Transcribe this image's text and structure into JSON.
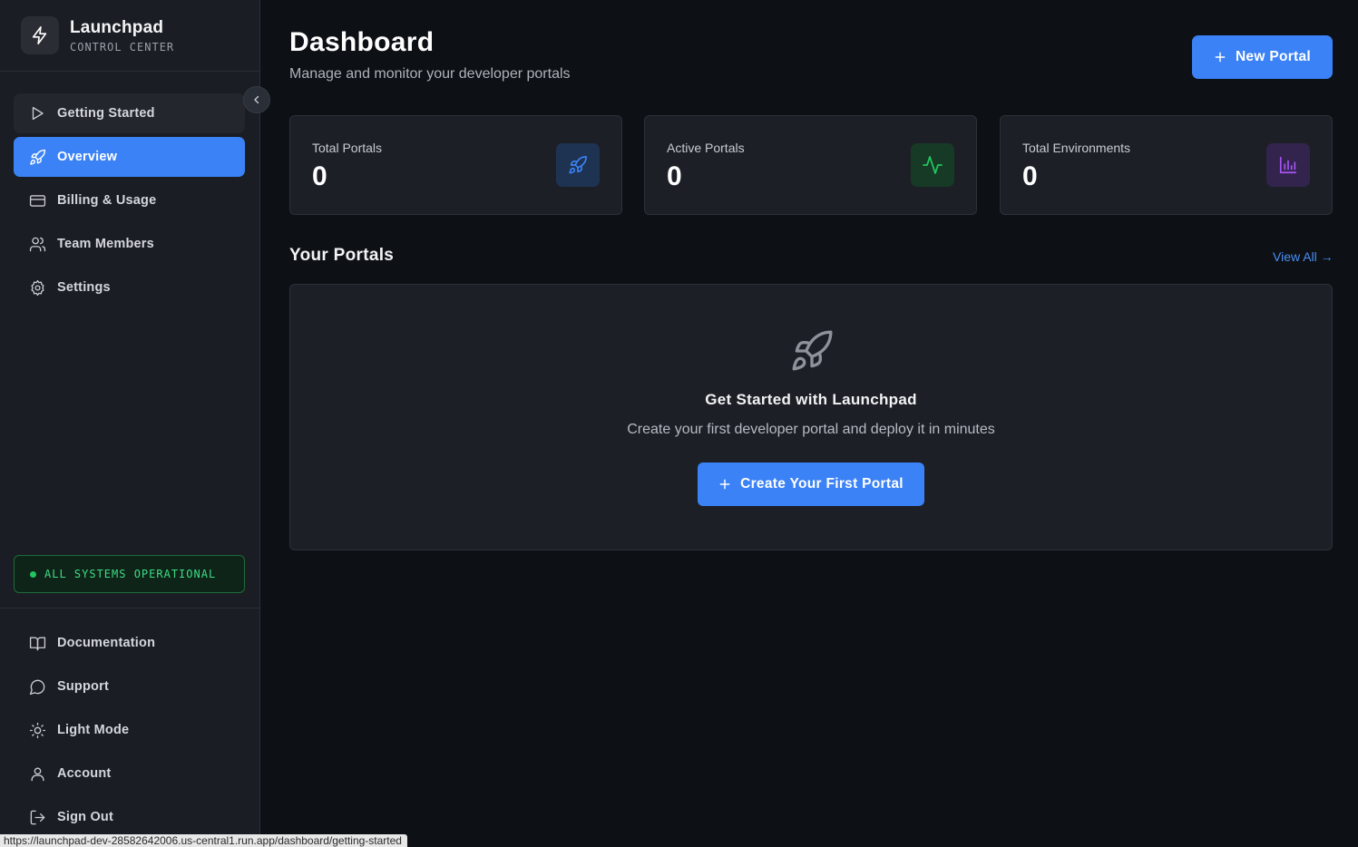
{
  "brand": {
    "name": "Launchpad",
    "subtitle": "CONTROL CENTER"
  },
  "sidebar": {
    "nav": [
      {
        "label": "Getting Started",
        "icon": "play-icon",
        "state": "hover"
      },
      {
        "label": "Overview",
        "icon": "rocket-icon",
        "state": "active"
      },
      {
        "label": "Billing & Usage",
        "icon": "credit-card-icon",
        "state": ""
      },
      {
        "label": "Team Members",
        "icon": "users-icon",
        "state": ""
      },
      {
        "label": "Settings",
        "icon": "gear-icon",
        "state": ""
      }
    ],
    "status": "ALL SYSTEMS OPERATIONAL",
    "bottom": [
      {
        "label": "Documentation",
        "icon": "book-icon"
      },
      {
        "label": "Support",
        "icon": "chat-bubble-icon"
      },
      {
        "label": "Light Mode",
        "icon": "sun-icon"
      },
      {
        "label": "Account",
        "icon": "user-icon"
      },
      {
        "label": "Sign Out",
        "icon": "sign-out-icon"
      }
    ]
  },
  "header": {
    "title": "Dashboard",
    "subtitle": "Manage and monitor your developer portals",
    "new_button": "New Portal"
  },
  "stats": [
    {
      "label": "Total Portals",
      "value": "0",
      "icon": "rocket-icon",
      "color": "#3b82f6",
      "bg": "#1e3352"
    },
    {
      "label": "Active Portals",
      "value": "0",
      "icon": "activity-icon",
      "color": "#22c55e",
      "bg": "#163a26"
    },
    {
      "label": "Total Environments",
      "value": "0",
      "icon": "bar-chart-icon",
      "color": "#a855f7",
      "bg": "#33244d"
    }
  ],
  "portals": {
    "title": "Your Portals",
    "view_all": "View All →",
    "empty_title": "Get Started with Launchpad",
    "empty_sub": "Create your first developer portal and deploy it in minutes",
    "cta": "Create Your First Portal"
  },
  "status_url": "https://launchpad-dev-28582642006.us-central1.run.app/dashboard/getting-started"
}
